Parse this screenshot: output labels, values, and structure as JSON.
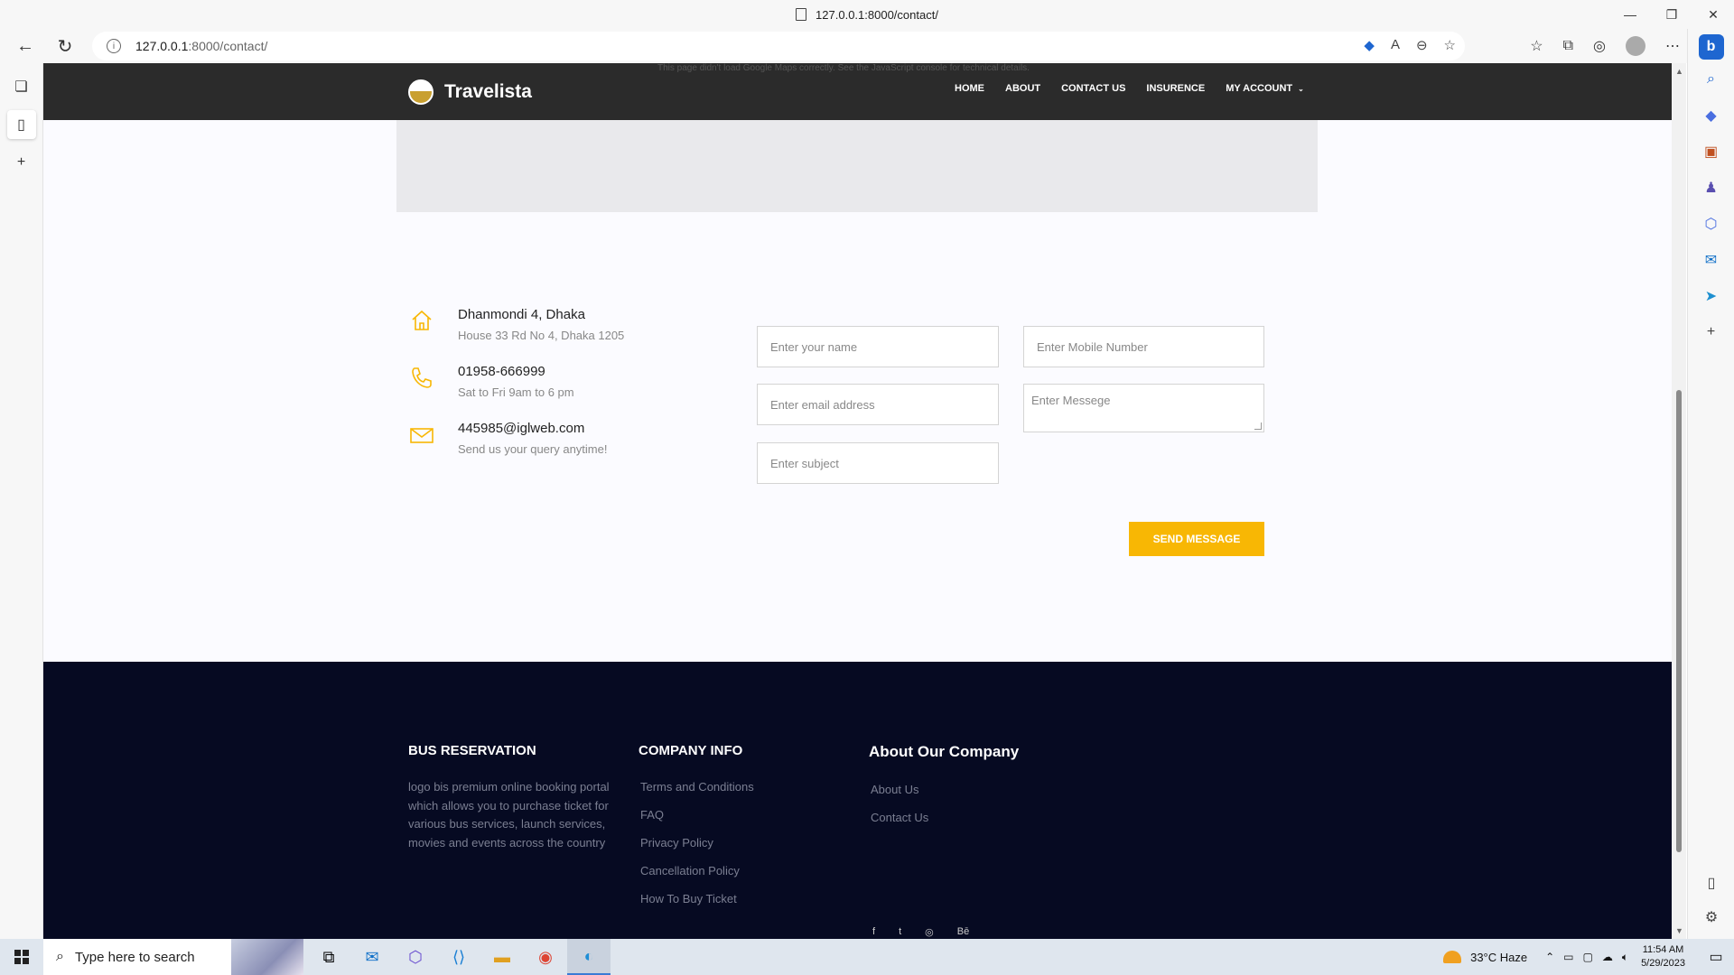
{
  "browser": {
    "tab_title": "127.0.0.1:8000/contact/",
    "url_host": "127.0.0.1",
    "url_rest": ":8000/contact/"
  },
  "site": {
    "brand": "Travelista",
    "map_notice": "This page didn't load Google Maps correctly. See the JavaScript console for technical details.",
    "nav": [
      "HOME",
      "ABOUT",
      "CONTACT US",
      "INSURENCE",
      "MY ACCOUNT"
    ]
  },
  "contact": {
    "items": [
      {
        "icon": "home-icon",
        "title": "Dhanmondi 4, Dhaka",
        "sub": "House 33 Rd No 4, Dhaka 1205"
      },
      {
        "icon": "phone-icon",
        "title": "01958-666999",
        "sub": "Sat to Fri 9am to 6 pm"
      },
      {
        "icon": "mail-icon",
        "title": "445985@iglweb.com",
        "sub": "Send us your query anytime!"
      }
    ]
  },
  "form": {
    "name_placeholder": "Enter your name",
    "mobile_placeholder": "Enter Mobile Number",
    "email_placeholder": "Enter email address",
    "message_placeholder": "Enter Messege",
    "subject_placeholder": "Enter subject",
    "submit_label": "SEND MESSAGE"
  },
  "footer": {
    "col1": {
      "heading": "BUS RESERVATION",
      "text": "logo bis premium online booking portal which allows you to purchase ticket for various bus services, launch services, movies and events across the country"
    },
    "col2": {
      "heading": "COMPANY INFO",
      "links": [
        "Terms and Conditions",
        "FAQ",
        "Privacy Policy",
        "Cancellation Policy",
        "How To Buy Ticket"
      ]
    },
    "col3": {
      "heading": "About Our Company",
      "links": [
        "About Us",
        "Contact Us"
      ]
    },
    "socials": [
      "f",
      "t",
      "◎",
      "Bē"
    ]
  },
  "taskbar": {
    "search_placeholder": "Type here to search",
    "weather": "33°C  Haze",
    "time": "11:54 AM",
    "date": "5/29/2023"
  },
  "colors": {
    "accent": "#f8b704",
    "header_bg": "#2b2b2b",
    "footer_bg": "#060a22"
  }
}
